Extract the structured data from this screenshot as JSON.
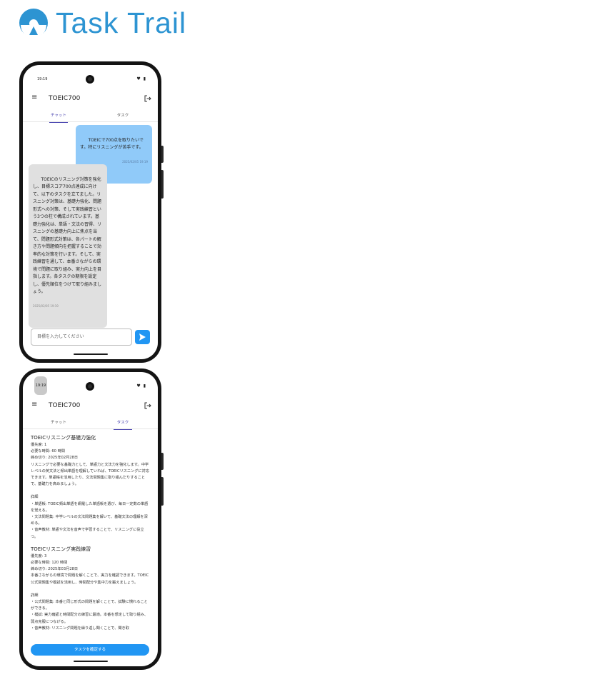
{
  "brand": {
    "name": "Task Trail",
    "color": "#2d94d2"
  },
  "phone_chat": {
    "status": {
      "time": "19:19",
      "icons": "♥ ▮"
    },
    "appbar": {
      "menu_icon": "menu-icon",
      "title": "TOEIC700",
      "logout_icon": "logout-icon"
    },
    "tabs": {
      "chat": "チャット",
      "task": "タスク",
      "active": "chat"
    },
    "messages": [
      {
        "role": "user",
        "text": "TOEICで700点を取りたいです。特にリスニングが苦手です。",
        "time": "2025/02/05 19:19"
      },
      {
        "role": "assistant",
        "text": "TOEICのリスニング対策を強化し、目標スコア700点達成に向けて、以下のタスクを立てました。リスニング対策は、基礎力強化、問題形式への対策、そして実践練習という3つの柱で構成されています。基礎力強化は、単語・文法の習得、リスニングの基礎力向上に焦点を当て、問題形式対策は、各パートの解き方や問題傾向を把握することで効率的な対策を行います。そして、実践練習を通して、本番さながらの環境で問題に取り組み、実力向上を目指します。各タスクの期限を設定し、優先順位をつけて取り組みましょう。",
        "time": "2025/02/05 19:19"
      }
    ],
    "composer": {
      "placeholder": "目標を入力してください"
    },
    "send_icon": "send-icon",
    "colors": {
      "user_bubble": "#90caf9",
      "assistant_bubble": "#e0e0e0",
      "accent": "#2196f3"
    }
  },
  "phone_task": {
    "status": {
      "time": "19:19",
      "icons": "♥ ▮"
    },
    "appbar": {
      "menu_icon": "menu-icon",
      "title": "TOEIC700",
      "logout_icon": "logout-icon"
    },
    "tabs": {
      "chat": "チャット",
      "task": "タスク",
      "active": "task"
    },
    "tasks": [
      {
        "title": "TOEICリスニング基礎力強化",
        "priority": "優先度: 1",
        "time": "必要な時間: 60 時間",
        "deadline": "締め切り: 2025年02月28日",
        "description": "リスニングで必要な基礎力として、単語力と文法力を強化します。中学レベルの英文法と頻出単語を理解していれば、TOEICリスニングに対応できます。単語帳を活用したり、文法問題集に取り組んだりすることで、基礎力を高めましょう。",
        "detail_heading": "詳細",
        "details": [
          "・単語帳: TOEIC頻出単語を網羅した単語帳を選び、毎日一定数の単語を覚える。",
          "・文法問題集: 中学レベルの文法問題集を解いて、基礎文法の理解を深める。",
          "・音声教材: 単語や文法を音声で学習することで、リスニングに役立つ。"
        ]
      },
      {
        "title": "TOEICリスニング実践練習",
        "priority": "優先度: 3",
        "time": "必要な時間: 120 時間",
        "deadline": "締め切り: 2025年03月28日",
        "description": "本番さながらの環境で問題を解くことで、実力を確認できます。TOEIC公式問題集や模試を活用し、時間配分や集中力を鍛えましょう。",
        "detail_heading": "詳細",
        "details": [
          "・公式問題集: 本番と同じ形式の問題を解くことで、試験に慣れることができる。",
          "・模試: 実力確認と時間配分の練習に最適。本番を想定して取り組み、弱点克服につなげる。",
          "・音声教材: リスニング問題を繰り返し聞くことで、聞き取"
        ]
      }
    ],
    "confirm_button": "タスクを確定する"
  }
}
